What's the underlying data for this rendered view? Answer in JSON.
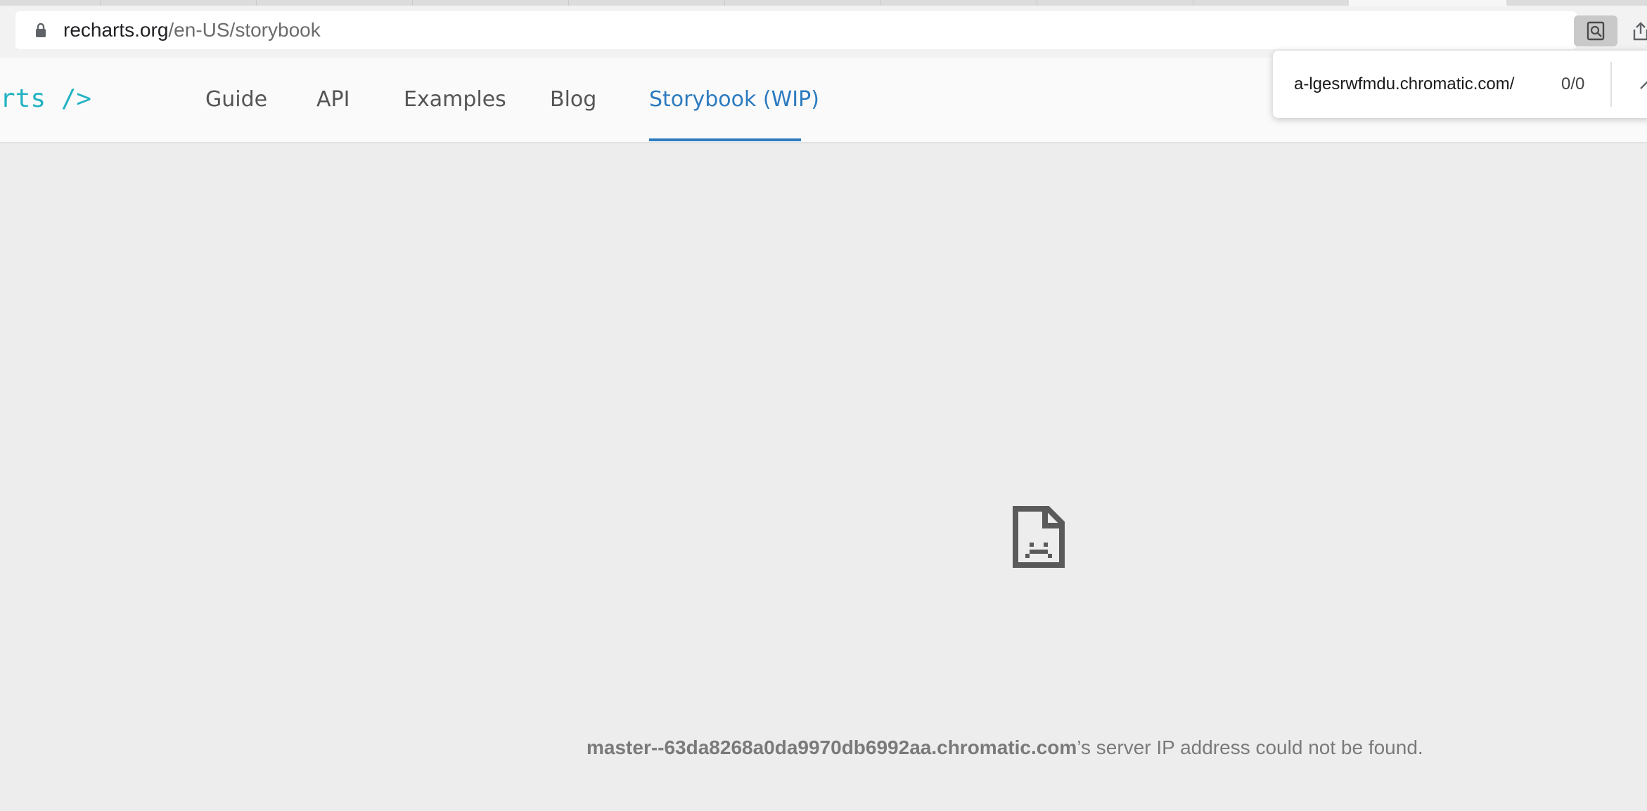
{
  "browser": {
    "address_bar": {
      "host": "recharts.org",
      "path": "/en-US/storybook"
    },
    "find_bar": {
      "query": "a-lgesrwfmdu.chromatic.com/",
      "count": "0/0"
    },
    "icons": {
      "lock": "lock-icon",
      "find_in_page": "find-in-page-icon",
      "share": "share-icon",
      "find_up": "chevron-up-icon"
    }
  },
  "site": {
    "logo_text": "rts />",
    "nav": {
      "guide": "Guide",
      "api": "API",
      "examples": "Examples",
      "blog": "Blog",
      "storybook": "Storybook (WIP)"
    },
    "active_color": "#2d7bbf",
    "logo_color": "#22b3c2"
  },
  "error": {
    "icon": "sad-file-icon",
    "host": "master--63da8268a0da9970db6992aa.chromatic.com",
    "message": "’s server IP address could not be found."
  }
}
